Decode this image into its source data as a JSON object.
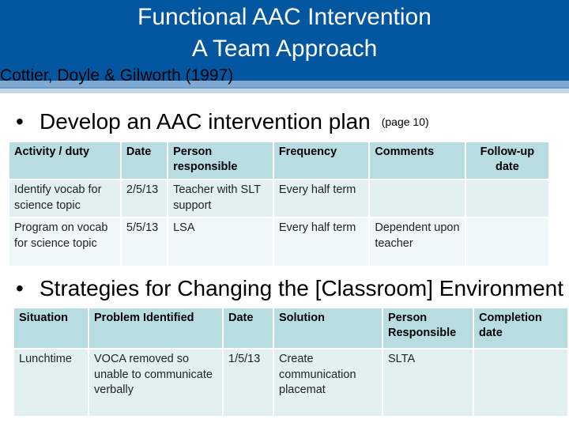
{
  "header": {
    "title_line1": "Functional AAC Intervention",
    "title_line2": "A Team Approach",
    "subtitle": "Cottier, Doyle & Gilworth (1997)",
    "colors": {
      "banner": "#0357A0",
      "stripe": "#7EA9D0",
      "header_cell": "#B7DDE3"
    }
  },
  "section1": {
    "bullet": "•",
    "heading": "Develop an AAC intervention plan",
    "note": "(page 10)",
    "table": {
      "columns": [
        "Activity / duty",
        "Date",
        "Person responsible",
        "Frequency",
        "Comments",
        "Follow-up date"
      ],
      "rows": [
        [
          "Identify vocab for science topic",
          "2/5/13",
          "Teacher with SLT support",
          "Every half term",
          "",
          ""
        ],
        [
          "Program on vocab for science topic",
          "5/5/13",
          "LSA",
          "Every half term",
          "Dependent upon teacher",
          ""
        ]
      ]
    }
  },
  "section2": {
    "bullet": "•",
    "heading": "Strategies for Changing the [Classroom] Environment",
    "table": {
      "columns": [
        "Situation",
        "Problem Identified",
        "Date",
        "Solution",
        "Person Responsible",
        "Completion date"
      ],
      "rows": [
        [
          "Lunchtime",
          "VOCA removed so unable to communicate verbally",
          "1/5/13",
          "Create communication placemat",
          "SLTA",
          ""
        ]
      ]
    }
  }
}
